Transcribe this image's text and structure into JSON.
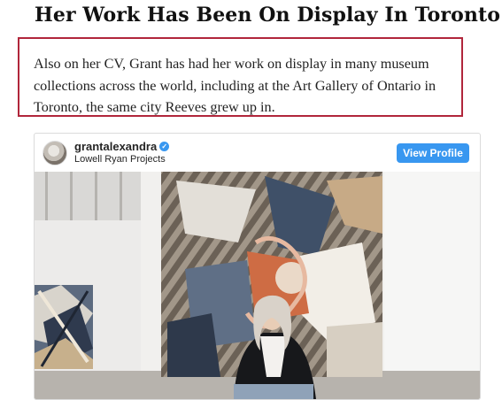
{
  "article": {
    "headline": "Her Work Has Been On Display In Toronto",
    "callout_text": "Also on her CV, Grant has had her work on display in many museum collections across the world, including at the Art Gallery of Ontario in Toronto, the same city Reeves grew up in."
  },
  "instagram_embed": {
    "username": "grantalexandra",
    "subtitle": "Lowell Ryan Projects",
    "view_profile_label": "View Profile",
    "button_color": "#3897f0",
    "verified_icon": "verified-badge"
  },
  "colors": {
    "callout_border": "#b1263b"
  }
}
